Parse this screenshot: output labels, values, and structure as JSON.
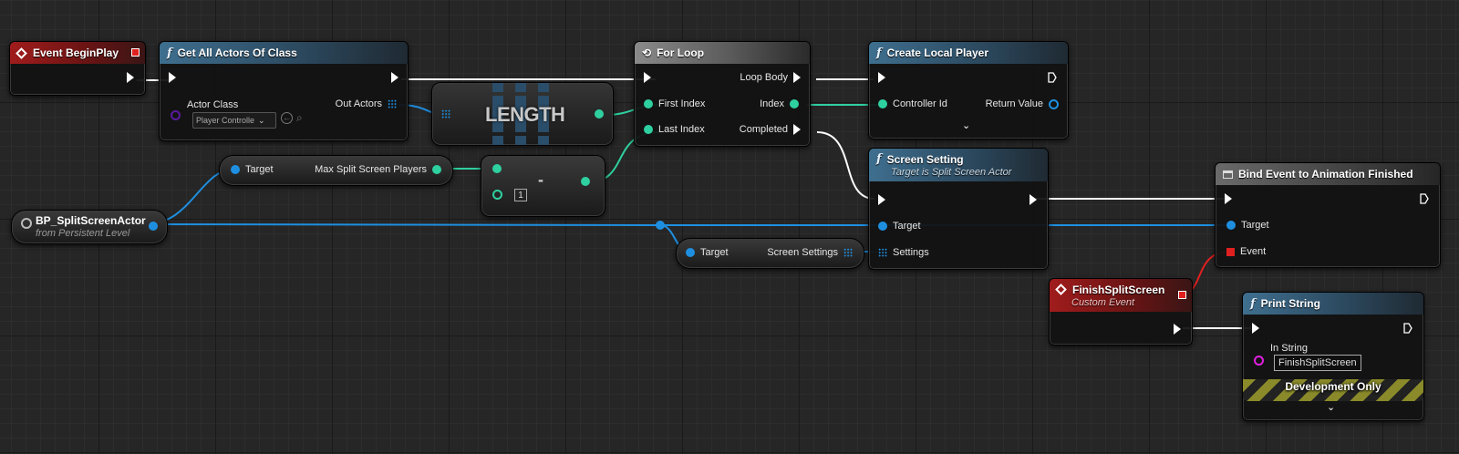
{
  "nodes": {
    "event_begin_play": {
      "title": "Event BeginPlay"
    },
    "get_all_actors": {
      "title": "Get All Actors Of Class",
      "actor_class_label": "Actor Class",
      "actor_class_value": "Player Controlle",
      "out_actors_label": "Out Actors"
    },
    "length": {
      "title": "LENGTH"
    },
    "for_loop": {
      "title": "For Loop",
      "loop_body": "Loop Body",
      "first_index": "First Index",
      "index": "Index",
      "last_index": "Last Index",
      "completed": "Completed"
    },
    "create_local_player": {
      "title": "Create Local Player",
      "controller_id": "Controller Id",
      "return_value": "Return Value"
    },
    "max_split_screen": {
      "target": "Target",
      "output": "Max Split Screen Players"
    },
    "subtract": {
      "op": "-",
      "b_value": "1"
    },
    "bp_actor": {
      "title": "BP_SplitScreenActor",
      "subtitle": "from Persistent Level"
    },
    "screen_setting": {
      "title": "Screen Setting",
      "subtitle": "Target is Split Screen Actor",
      "target": "Target",
      "settings": "Settings"
    },
    "screen_settings_getter": {
      "target": "Target",
      "output": "Screen Settings"
    },
    "bind_event": {
      "title": "Bind Event to Animation Finished",
      "target": "Target",
      "event": "Event"
    },
    "finish_split_screen": {
      "title": "FinishSplitScreen",
      "subtitle": "Custom Event"
    },
    "print_string": {
      "title": "Print String",
      "in_string": "In String",
      "in_string_value": "FinishSplitScreen",
      "dev_only": "Development Only"
    }
  },
  "colors": {
    "exec": "#ffffff",
    "object": "#1e8fe0",
    "integer": "#2fd0a0",
    "class": "#5a1aa0",
    "string": "#e020e0",
    "delegate": "#e02020",
    "event_header": "#a11c1c",
    "function_header": "#3f6f8f"
  }
}
